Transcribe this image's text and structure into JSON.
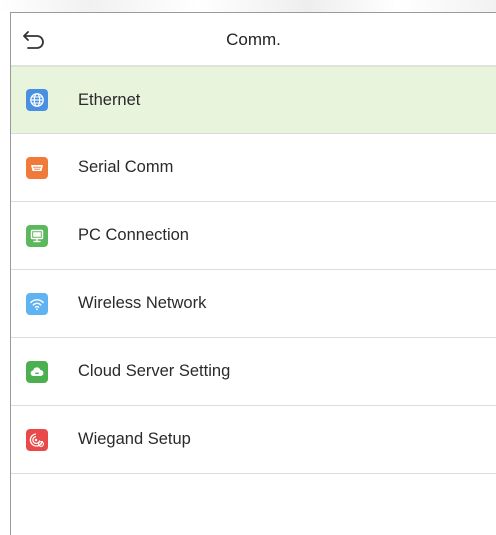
{
  "header": {
    "title": "Comm.",
    "back_icon": "back-arrow-icon"
  },
  "menu": {
    "selected_index": 0,
    "items": [
      {
        "label": "Ethernet",
        "icon": "globe-icon",
        "color": "#4a90e2"
      },
      {
        "label": "Serial Comm",
        "icon": "serial-port-icon",
        "color": "#f07a3a"
      },
      {
        "label": "PC Connection",
        "icon": "monitor-icon",
        "color": "#5cb85c"
      },
      {
        "label": "Wireless Network",
        "icon": "wifi-icon",
        "color": "#5fb3f0"
      },
      {
        "label": "Cloud Server Setting",
        "icon": "cloud-icon",
        "color": "#4caf50"
      },
      {
        "label": "Wiegand Setup",
        "icon": "wiegand-icon",
        "color": "#e84a4a"
      }
    ]
  },
  "colors": {
    "selected_row": "#e8f5dc",
    "divider": "#dcdcdc",
    "text": "#2a2a2a"
  }
}
